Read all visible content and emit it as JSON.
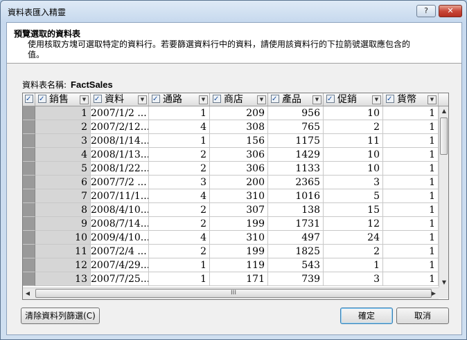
{
  "window": {
    "title": "資料表匯入精靈",
    "help_label": "?",
    "close_label": "✕"
  },
  "header": {
    "title": "預覽選取的資料表",
    "description": "使用核取方塊可選取特定的資料行。若要篩選資料行中的資料，請使用該資料行的下拉箭號選取應包含的值。"
  },
  "table_name": {
    "label": "資料表名稱:",
    "value": "FactSales"
  },
  "grid": {
    "columns": [
      "銷售",
      "資料",
      "通路",
      "商店",
      "產品",
      "促銷",
      "貨幣"
    ],
    "rows": [
      [
        "1",
        "2007/1/2 ...",
        "1",
        "209",
        "956",
        "10",
        "1"
      ],
      [
        "2",
        "2007/2/12...",
        "4",
        "308",
        "765",
        "2",
        "1"
      ],
      [
        "3",
        "2008/1/14...",
        "1",
        "156",
        "1175",
        "11",
        "1"
      ],
      [
        "4",
        "2008/1/13...",
        "2",
        "306",
        "1429",
        "10",
        "1"
      ],
      [
        "5",
        "2008/1/22...",
        "2",
        "306",
        "1133",
        "10",
        "1"
      ],
      [
        "6",
        "2007/7/2 ...",
        "3",
        "200",
        "2365",
        "3",
        "1"
      ],
      [
        "7",
        "2007/11/1...",
        "4",
        "310",
        "1016",
        "5",
        "1"
      ],
      [
        "8",
        "2008/4/10...",
        "2",
        "307",
        "138",
        "15",
        "1"
      ],
      [
        "9",
        "2008/7/14...",
        "2",
        "199",
        "1731",
        "12",
        "1"
      ],
      [
        "10",
        "2009/4/10...",
        "4",
        "310",
        "497",
        "24",
        "1"
      ],
      [
        "11",
        "2007/2/4 ...",
        "2",
        "199",
        "1825",
        "2",
        "1"
      ],
      [
        "12",
        "2007/4/29...",
        "1",
        "119",
        "543",
        "1",
        "1"
      ],
      [
        "13",
        "2007/7/25...",
        "1",
        "171",
        "739",
        "3",
        "1"
      ]
    ],
    "hscroll_grip": "III"
  },
  "buttons": {
    "clear_filters": "清除資料列篩選(C)",
    "ok": "確定",
    "cancel": "取消"
  }
}
